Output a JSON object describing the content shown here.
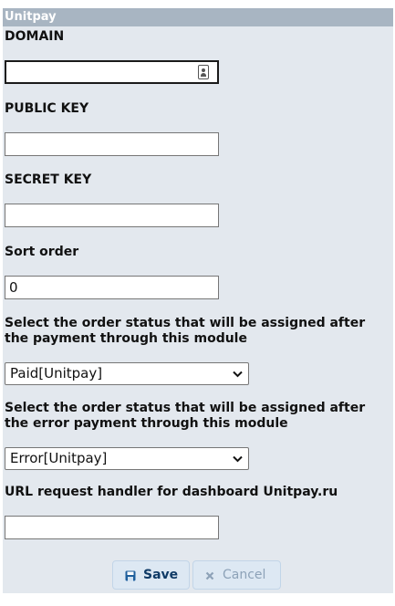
{
  "panel": {
    "title": "Unitpay"
  },
  "fields": {
    "domain": {
      "label": "DOMAIN",
      "value": ""
    },
    "public_key": {
      "label": "PUBLIC KEY",
      "value": ""
    },
    "secret_key": {
      "label": "SECRET KEY",
      "value": ""
    },
    "sort_order": {
      "label": "Sort order",
      "value": "0"
    },
    "success_status": {
      "label": "Select the order status that will be assigned after the payment through this module",
      "selected": "Paid[Unitpay]"
    },
    "error_status": {
      "label": "Select the order status that will be assigned after the error payment through this module",
      "selected": "Error[Unitpay]"
    },
    "handler_url": {
      "label": "URL request handler for dashboard Unitpay.ru",
      "value": ""
    }
  },
  "buttons": {
    "save": {
      "label": "Save",
      "icon": "floppy-disk-icon"
    },
    "cancel": {
      "label": "Cancel",
      "icon": "close-icon"
    }
  },
  "colors": {
    "panel_bg": "#e3e8ee",
    "title_bg": "#a8b5c2",
    "button_bg": "#dde8f3",
    "save_text": "#0f3a66",
    "cancel_text": "#8da2b8"
  }
}
